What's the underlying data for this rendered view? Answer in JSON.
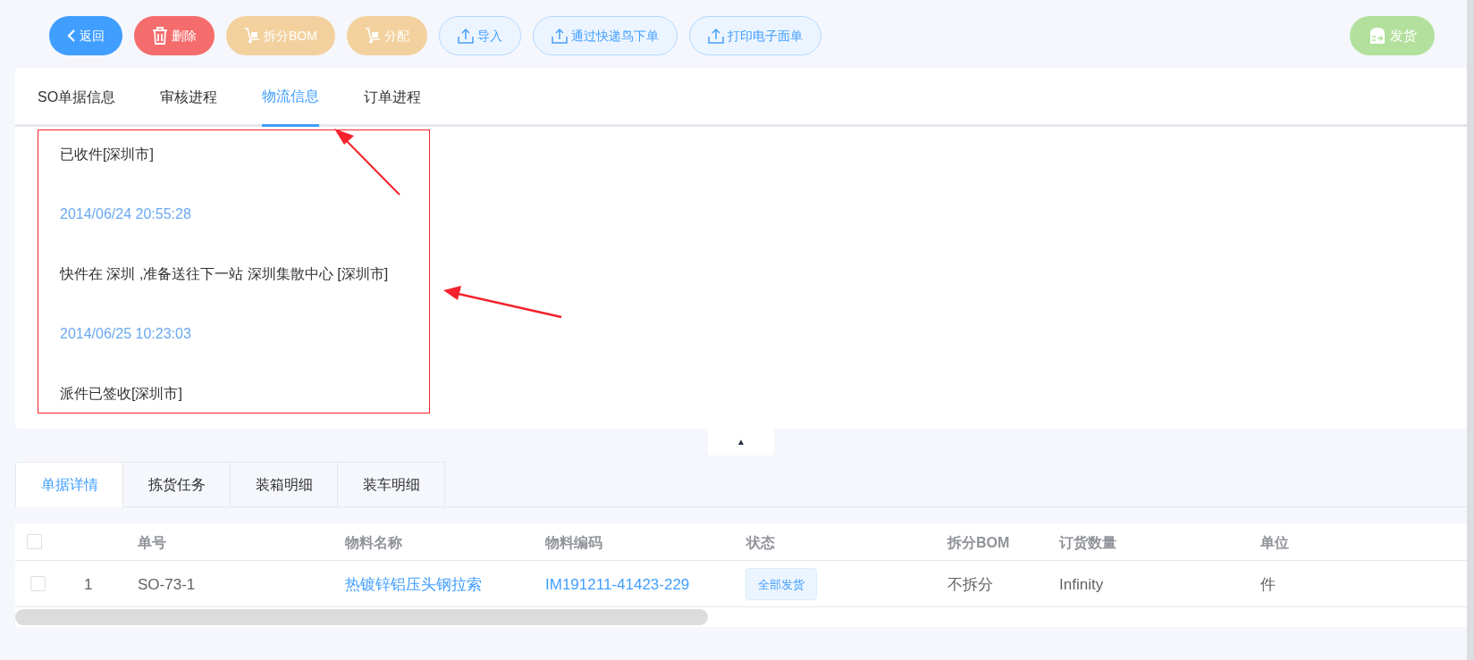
{
  "toolbar": [
    {
      "label": "返回",
      "kind": "back"
    },
    {
      "label": "删除",
      "kind": "delete"
    },
    {
      "label": "拆分BOM",
      "kind": "split"
    },
    {
      "label": "分配",
      "kind": "assign"
    },
    {
      "label": "导入",
      "kind": "upload"
    },
    {
      "label": "通过快递鸟下单",
      "kind": "upload"
    },
    {
      "label": "打印电子面单",
      "kind": "upload"
    }
  ],
  "ship_button": {
    "label": "发货"
  },
  "info_tabs": [
    {
      "label": "SO单据信息",
      "selected": false
    },
    {
      "label": "审核进程",
      "selected": false
    },
    {
      "label": "物流信息",
      "selected": true
    },
    {
      "label": "订单进程",
      "selected": false
    }
  ],
  "logistics": [
    {
      "kind": "event",
      "text": "已收件[深圳市]"
    },
    {
      "kind": "time",
      "text": "2014/06/24 20:55:28"
    },
    {
      "kind": "event",
      "text": "快件在 深圳 ,准备送往下一站 深圳集散中心 [深圳市]"
    },
    {
      "kind": "time",
      "text": "2014/06/25 10:23:03"
    },
    {
      "kind": "event",
      "text": "派件已签收[深圳市]"
    }
  ],
  "collapse_toggle": {
    "label": "▲"
  },
  "detail_tabs": [
    {
      "label": "单据详情",
      "selected": true
    },
    {
      "label": "拣货任务",
      "selected": false
    },
    {
      "label": "装箱明细",
      "selected": false
    },
    {
      "label": "装车明细",
      "selected": false
    }
  ],
  "table": {
    "all_checked": false,
    "columns": [
      "单号",
      "物料名称",
      "物料编码",
      "状态",
      "拆分BOM",
      "订货数量",
      "单位"
    ],
    "rows": [
      {
        "checked": false,
        "index": "1",
        "order_no": "SO-73-1",
        "material_name": "热镀锌铝压头钢拉索",
        "material_code": "IM191211-41423-229",
        "status": "全部发货",
        "split_bom": "不拆分",
        "quantity": "Infinity",
        "unit": "件"
      }
    ]
  }
}
